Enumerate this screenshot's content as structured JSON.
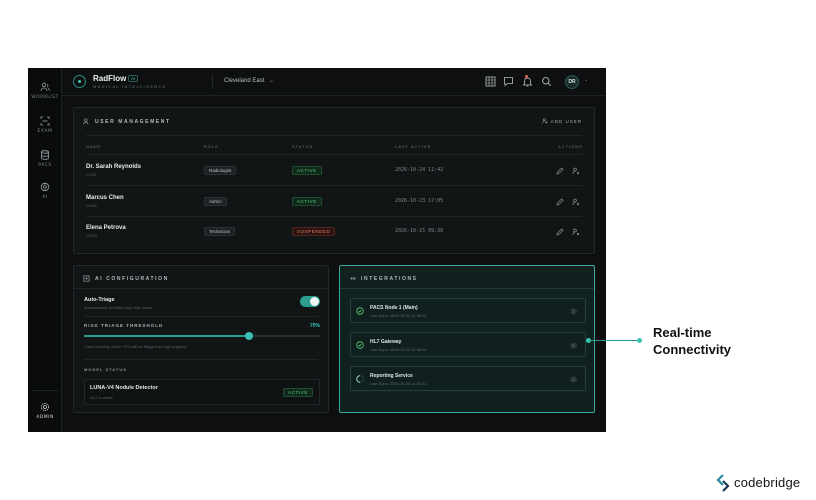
{
  "rail": {
    "items": [
      {
        "label": "WORKLIST",
        "icon": "users-icon"
      },
      {
        "label": "EXAM",
        "icon": "scan-icon"
      },
      {
        "label": "PACS",
        "icon": "database-icon"
      },
      {
        "label": "AI",
        "icon": "brain-icon"
      }
    ],
    "admin_label": "ADMIN"
  },
  "header": {
    "brand": "RadFlow",
    "brand_badge": "AI",
    "brand_subtitle": "MEDICAL INTELLIGENCE",
    "location": "Cleveland East",
    "avatar_initials": "DR"
  },
  "users": {
    "title": "USER MANAGEMENT",
    "add_label": "ADD USER",
    "columns": [
      "NAME",
      "ROLE",
      "STATUS",
      "LAST ACTIVE",
      "ACTIONS"
    ],
    "rows": [
      {
        "name": "Dr. Sarah Reynolds",
        "id": "U-001",
        "role": "Radiologist",
        "status": "ACTIVE",
        "last_active": "2026-10-24 11:42"
      },
      {
        "name": "Marcus Chen",
        "id": "U-002",
        "role": "Admin",
        "status": "ACTIVE",
        "last_active": "2026-10-23 17:05"
      },
      {
        "name": "Elena Petrova",
        "id": "U-003",
        "role": "Technician",
        "status": "SUSPENDED",
        "last_active": "2026-10-15 09:30"
      }
    ]
  },
  "ai_config": {
    "title": "AI CONFIGURATION",
    "auto_triage_label": "Auto-Triage",
    "auto_triage_desc": "Automatically prioritize high-risk cases",
    "auto_triage_on": true,
    "threshold_label": "RISK TRIAGE THRESHOLD",
    "threshold_value": "70%",
    "threshold_fraction": 0.7,
    "threshold_note": "Cases scoring above 70% will be flagged as high urgency.",
    "model_status_label": "MODEL STATUS",
    "model_name": "LUNA-V4 Nodule Detector",
    "model_version": "v4.2.0-stable",
    "model_status": "ACTIVE"
  },
  "integrations": {
    "title": "INTEGRATIONS",
    "items": [
      {
        "name": "PACS Node 1 (Main)",
        "sync": "Last Sync: 2026-10-24 11:38:02",
        "state": "ok"
      },
      {
        "name": "HL7 Gateway",
        "sync": "Last Sync: 2026-10-24 11:38:00",
        "state": "ok"
      },
      {
        "name": "Reporting Service",
        "sync": "Last Sync: 2026-10-24 11:34:11",
        "state": "syncing"
      }
    ]
  },
  "callout": {
    "line1": "Real-time",
    "line2": "Connectivity"
  },
  "footer_brand": "codebridge",
  "colors": {
    "accent": "#2b9e8f",
    "active": "#54d07d",
    "suspended": "#ef7a6c"
  }
}
